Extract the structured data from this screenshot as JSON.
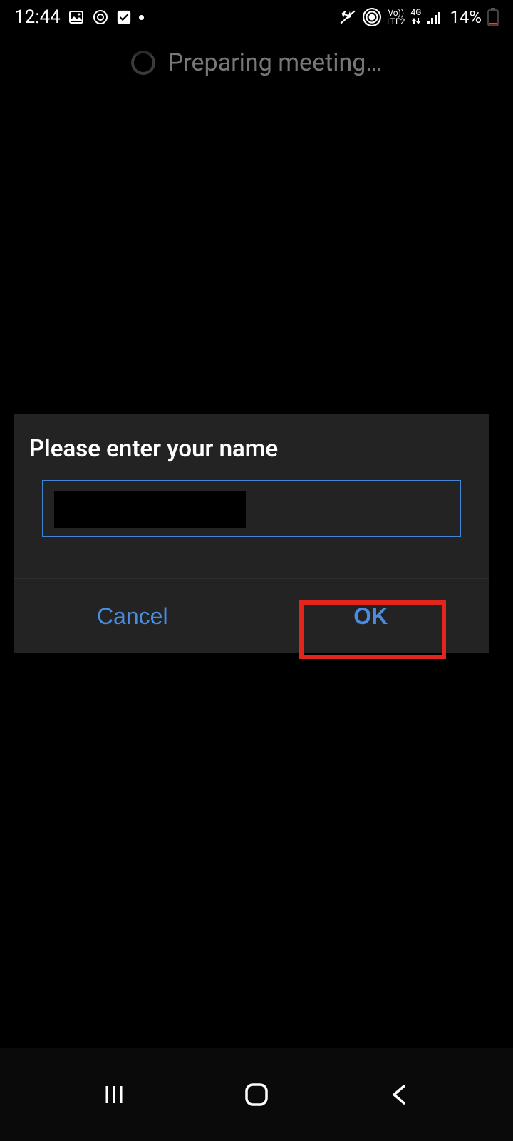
{
  "statusbar": {
    "time": "12:44",
    "battery": "14%",
    "net_label": "4G",
    "lte_label": "LTE2",
    "vo_label": "Vo))"
  },
  "header": {
    "loading_text": "Preparing meeting…"
  },
  "dialog": {
    "title": "Please enter your name",
    "input_value": "",
    "cancel_label": "Cancel",
    "ok_label": "OK"
  },
  "highlight": {
    "target": "ok-button"
  }
}
